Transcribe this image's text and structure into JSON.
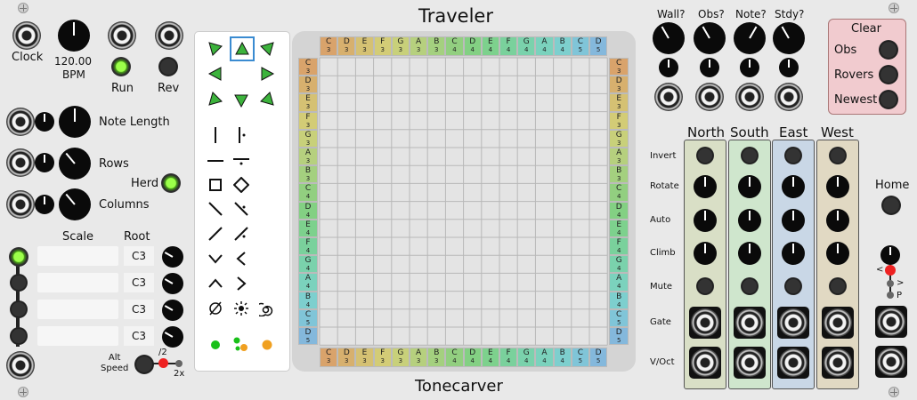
{
  "header": {
    "title": "Traveler",
    "footer": "Tonecarver"
  },
  "clock": {
    "label": "Clock",
    "bpm_value": "120.00",
    "bpm_label": "BPM",
    "run_label": "Run",
    "rev_label": "Rev"
  },
  "controls": {
    "note_length": "Note Length",
    "rows": "Rows",
    "columns": "Columns",
    "herd": "Herd"
  },
  "scale": {
    "scale_header": "Scale",
    "root_header": "Root",
    "roots": [
      "C3",
      "C3",
      "C3",
      "C3"
    ],
    "alt_speed_label": "Alt\nSpeed",
    "half": "/2",
    "double": "2x"
  },
  "top_right": {
    "wall": "Wall?",
    "obs": "Obs?",
    "note": "Note?",
    "stdy": "Stdy?"
  },
  "clear": {
    "title": "Clear",
    "obs": "Obs",
    "rovers": "Rovers",
    "newest": "Newest"
  },
  "directions": {
    "headers": [
      "North",
      "South",
      "East",
      "West"
    ],
    "colors": [
      "#d9dfc6",
      "#cfe6cd",
      "#c9d7e6",
      "#e1d9c3"
    ],
    "rows": [
      "Invert",
      "Rotate",
      "Auto",
      "Climb",
      "Mute",
      "Gate",
      "V/Oct"
    ]
  },
  "home": {
    "label": "Home",
    "lt": "<",
    "gt": ">",
    "p": "P"
  },
  "grid": {
    "columns": [
      {
        "n": "C",
        "o": "3",
        "c": "#d9a36b"
      },
      {
        "n": "D",
        "o": "3",
        "c": "#d7b06e"
      },
      {
        "n": "E",
        "o": "3",
        "c": "#d5c173"
      },
      {
        "n": "F",
        "o": "3",
        "c": "#d3cc76"
      },
      {
        "n": "G",
        "o": "3",
        "c": "#c8d07a"
      },
      {
        "n": "A",
        "o": "3",
        "c": "#b6d07e"
      },
      {
        "n": "B",
        "o": "3",
        "c": "#a4d07f"
      },
      {
        "n": "C",
        "o": "4",
        "c": "#92cf80"
      },
      {
        "n": "D",
        "o": "4",
        "c": "#83d083"
      },
      {
        "n": "E",
        "o": "4",
        "c": "#7dd18d"
      },
      {
        "n": "F",
        "o": "4",
        "c": "#7ad19c"
      },
      {
        "n": "G",
        "o": "4",
        "c": "#7ad2ac"
      },
      {
        "n": "A",
        "o": "4",
        "c": "#7bd2bd"
      },
      {
        "n": "B",
        "o": "4",
        "c": "#7dcfce"
      },
      {
        "n": "C",
        "o": "5",
        "c": "#80c5d8"
      },
      {
        "n": "D",
        "o": "5",
        "c": "#84b8dc"
      }
    ],
    "rows": [
      {
        "n": "C",
        "o": "3",
        "c": "#d9a36b"
      },
      {
        "n": "D",
        "o": "3",
        "c": "#d7b06e"
      },
      {
        "n": "E",
        "o": "3",
        "c": "#d5c173"
      },
      {
        "n": "F",
        "o": "3",
        "c": "#d3cc76"
      },
      {
        "n": "G",
        "o": "3",
        "c": "#c8d07a"
      },
      {
        "n": "A",
        "o": "3",
        "c": "#b6d07e"
      },
      {
        "n": "B",
        "o": "3",
        "c": "#a4d07f"
      },
      {
        "n": "C",
        "o": "4",
        "c": "#92cf80"
      },
      {
        "n": "D",
        "o": "4",
        "c": "#83d083"
      },
      {
        "n": "E",
        "o": "4",
        "c": "#7dd18d"
      },
      {
        "n": "F",
        "o": "4",
        "c": "#7ad19c"
      },
      {
        "n": "G",
        "o": "4",
        "c": "#7ad2ac"
      },
      {
        "n": "A",
        "o": "4",
        "c": "#7bd2bd"
      },
      {
        "n": "B",
        "o": "4",
        "c": "#7dcfce"
      },
      {
        "n": "C",
        "o": "5",
        "c": "#80c5d8"
      },
      {
        "n": "D",
        "o": "5",
        "c": "#84b8dc"
      }
    ]
  },
  "shape_icons": [
    "arrow-up-left-icon",
    "arrow-up-icon",
    "arrow-up-right-icon",
    "arrow-left-icon",
    "arrow-right-icon",
    "arrow-down-left-icon",
    "arrow-down-icon",
    "arrow-down-right-icon",
    "vertical-wall-icon",
    "vertical-dotted-wall-icon",
    "horizontal-wall-icon",
    "horizontal-dotted-wall-icon",
    "square-icon",
    "diamond-icon",
    "backslash-wall-icon",
    "backslash-dotted-icon",
    "slash-wall-icon",
    "slash-dotted-icon",
    "chevron-down-icon",
    "chevron-left-icon",
    "chevron-up-icon",
    "chevron-right-icon",
    "empty-set-icon",
    "burst-icon",
    "spiral-icon",
    "single-rover-icon",
    "multi-rover-icon",
    "orange-dot-icon"
  ]
}
